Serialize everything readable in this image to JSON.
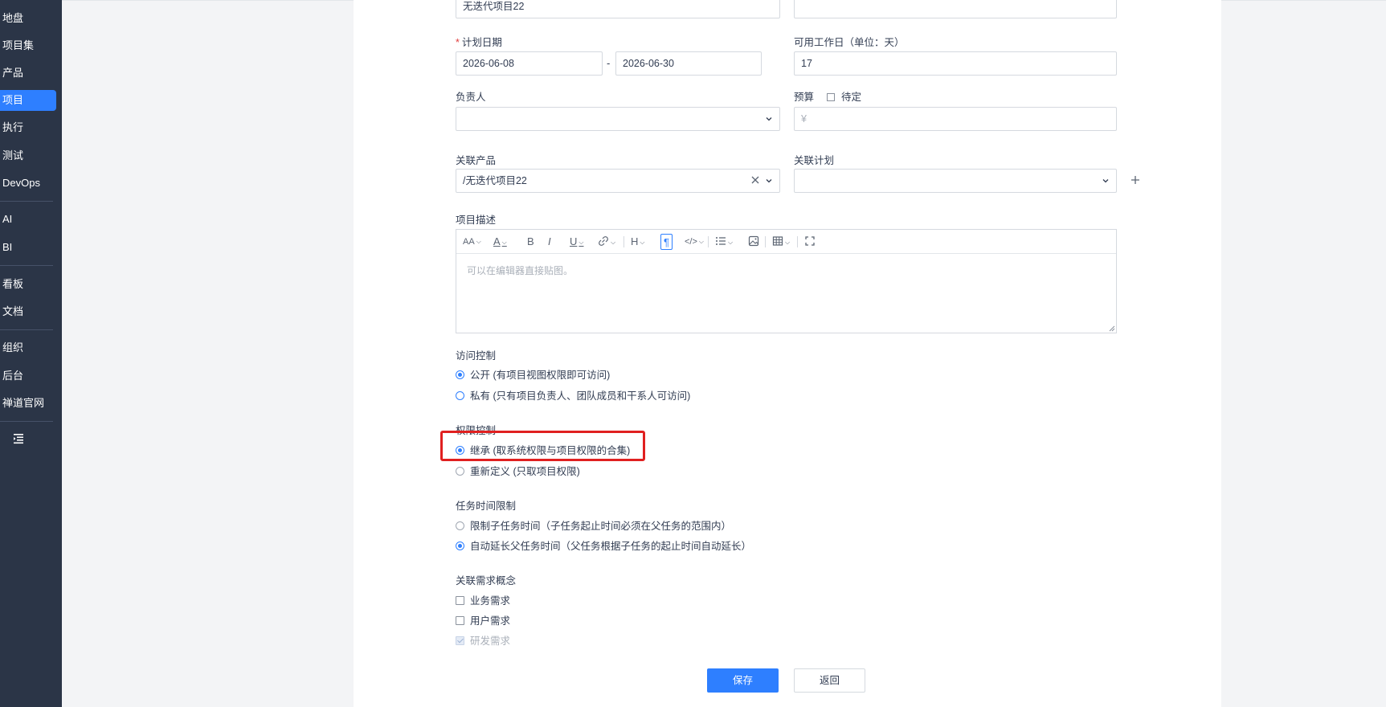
{
  "sidebar": {
    "items": [
      {
        "label": "地盘"
      },
      {
        "label": "项目集"
      },
      {
        "label": "产品"
      },
      {
        "label": "项目"
      },
      {
        "label": "执行"
      },
      {
        "label": "测试"
      },
      {
        "label": "DevOps"
      },
      {
        "label": "AI"
      },
      {
        "label": "BI"
      },
      {
        "label": "看板"
      },
      {
        "label": "文档"
      },
      {
        "label": "组织"
      },
      {
        "label": "后台"
      },
      {
        "label": "禅道官网"
      }
    ],
    "active": "项目"
  },
  "form": {
    "name_value": "无迭代项目22",
    "plan_date_label": "计划日期",
    "plan_date_required": "*",
    "begin_date": "2026-06-08",
    "date_separator": "-",
    "end_date": "2026-06-30",
    "workdays_label": "可用工作日（单位：天）",
    "workdays_value": "17",
    "owner_label": "负责人",
    "owner_value": "",
    "budget_label": "预算",
    "budget_tbd_label": "待定",
    "budget_placeholder": "¥",
    "product_label": "关联产品",
    "product_value": "/无迭代项目22",
    "plan_label": "关联计划",
    "plan_value": "",
    "desc_label": "项目描述",
    "editor_placeholder": "可以在编辑器直接贴图。",
    "acl_label": "访问控制",
    "acl_options": [
      {
        "label": "公开 (有项目视图权限即可访问)",
        "checked": true
      },
      {
        "label": "私有 (只有项目负责人、团队成员和干系人可访问)",
        "checked": false
      }
    ],
    "auth_label": "权限控制",
    "auth_options": [
      {
        "label": "继承 (取系统权限与项目权限的合集)",
        "checked": true
      },
      {
        "label": "重新定义 (只取项目权限)",
        "checked": false
      }
    ],
    "task_time_label": "任务时间限制",
    "task_time_options": [
      {
        "label": "限制子任务时间（子任务起止时间必须在父任务的范围内）",
        "checked": false
      },
      {
        "label": "自动延长父任务时间（父任务根据子任务的起止时间自动延长）",
        "checked": true
      }
    ],
    "story_concept_label": "关联需求概念",
    "story_concepts": [
      {
        "label": "业务需求",
        "checked": false,
        "disabled": false
      },
      {
        "label": "用户需求",
        "checked": false,
        "disabled": false
      },
      {
        "label": "研发需求",
        "checked": true,
        "disabled": true
      }
    ],
    "save_label": "保存",
    "back_label": "返回"
  },
  "editor_toolbar": {
    "icons": [
      "font-size-icon",
      "font-color-icon",
      "bold-icon",
      "italic-icon",
      "underline-icon",
      "link-icon",
      "heading-icon",
      "paragraph-icon",
      "code-icon",
      "list-icon",
      "image-icon",
      "table-icon",
      "fullscreen-icon"
    ],
    "labels": {
      "font_size": "AA",
      "font_color": "A",
      "bold": "B",
      "italic": "I",
      "underline": "U",
      "heading": "H",
      "paragraph": "¶",
      "code": "</>"
    }
  },
  "colors": {
    "sidebar_bg": "#2b3547",
    "accent": "#2e7fff",
    "highlight_box": "#e02020"
  }
}
